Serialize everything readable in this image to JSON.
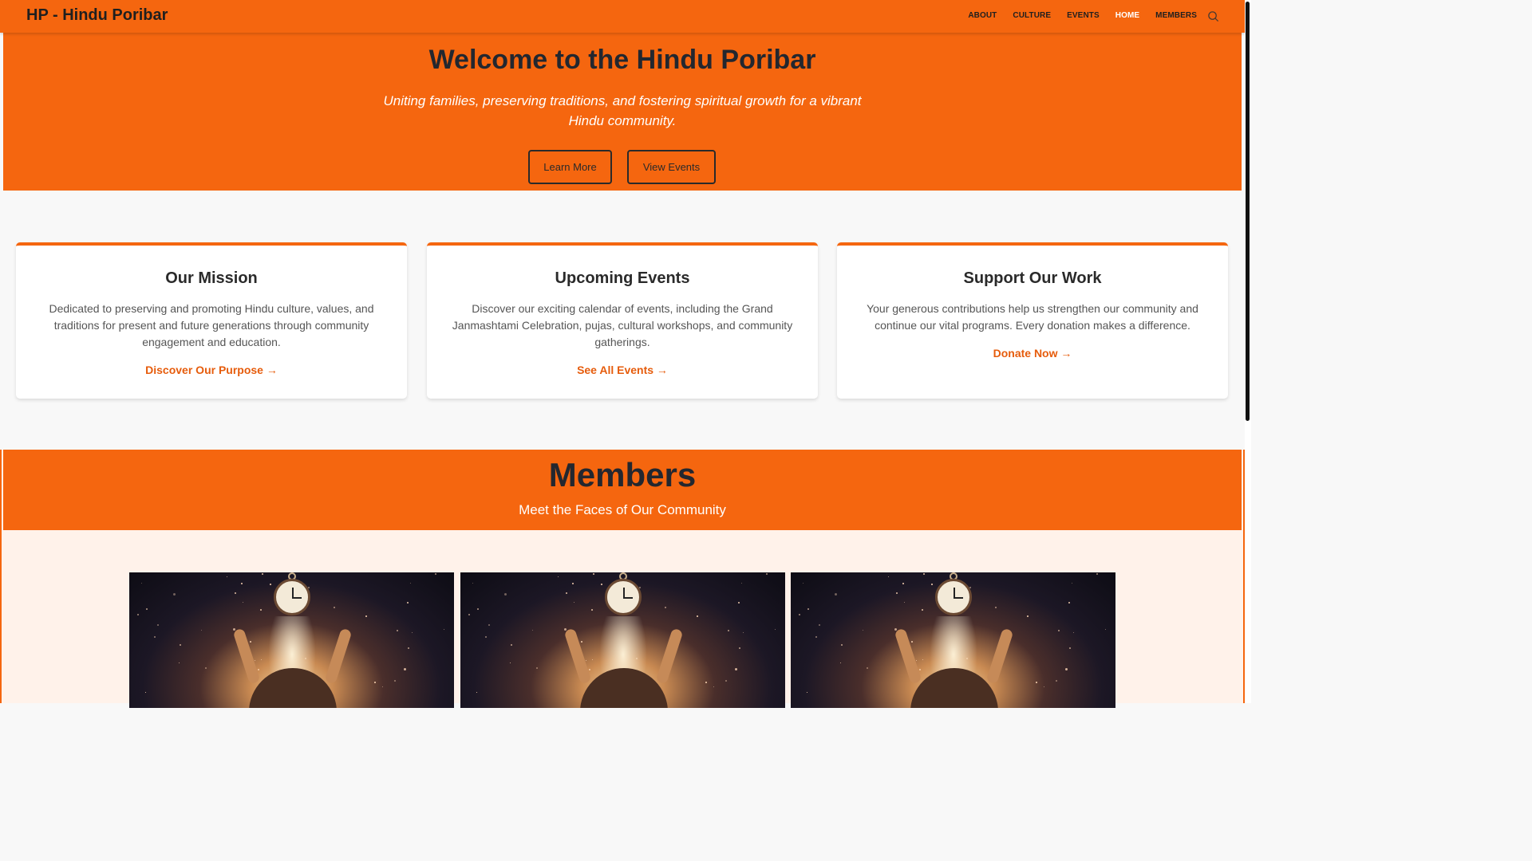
{
  "brand": "HP - Hindu Poribar",
  "nav": {
    "items": [
      {
        "label": "ABOUT",
        "active": false
      },
      {
        "label": "CULTURE",
        "active": false
      },
      {
        "label": "EVENTS",
        "active": false
      },
      {
        "label": "HOME",
        "active": true
      },
      {
        "label": "MEMBERS",
        "active": false
      }
    ],
    "search_icon": "search-icon"
  },
  "hero": {
    "title": "Welcome to the Hindu Poribar",
    "subtitle": "Uniting families, preserving traditions, and fostering spiritual growth for a vibrant Hindu community.",
    "btn_learn": "Learn More",
    "btn_events": "View Events"
  },
  "cards": [
    {
      "title": "Our Mission",
      "text": "Dedicated to preserving and promoting Hindu culture, values, and traditions for present and future generations through community engagement and education.",
      "link": "Discover Our Purpose →"
    },
    {
      "title": "Upcoming Events",
      "text": "Discover our exciting calendar of events, including the Grand Janmashtami Celebration, pujas, cultural workshops, and community gatherings.",
      "link": "See All Events →"
    },
    {
      "title": "Support Our Work",
      "text": "Your generous contributions help us strengthen our community and continue our vital programs. Every donation makes a difference.",
      "link": "Donate Now →"
    }
  ],
  "members": {
    "title": "Members",
    "subtitle": "Meet the Faces of Our Community"
  },
  "colors": {
    "accent": "#f5660f",
    "link": "#e65c0c",
    "dark": "#23272f"
  }
}
